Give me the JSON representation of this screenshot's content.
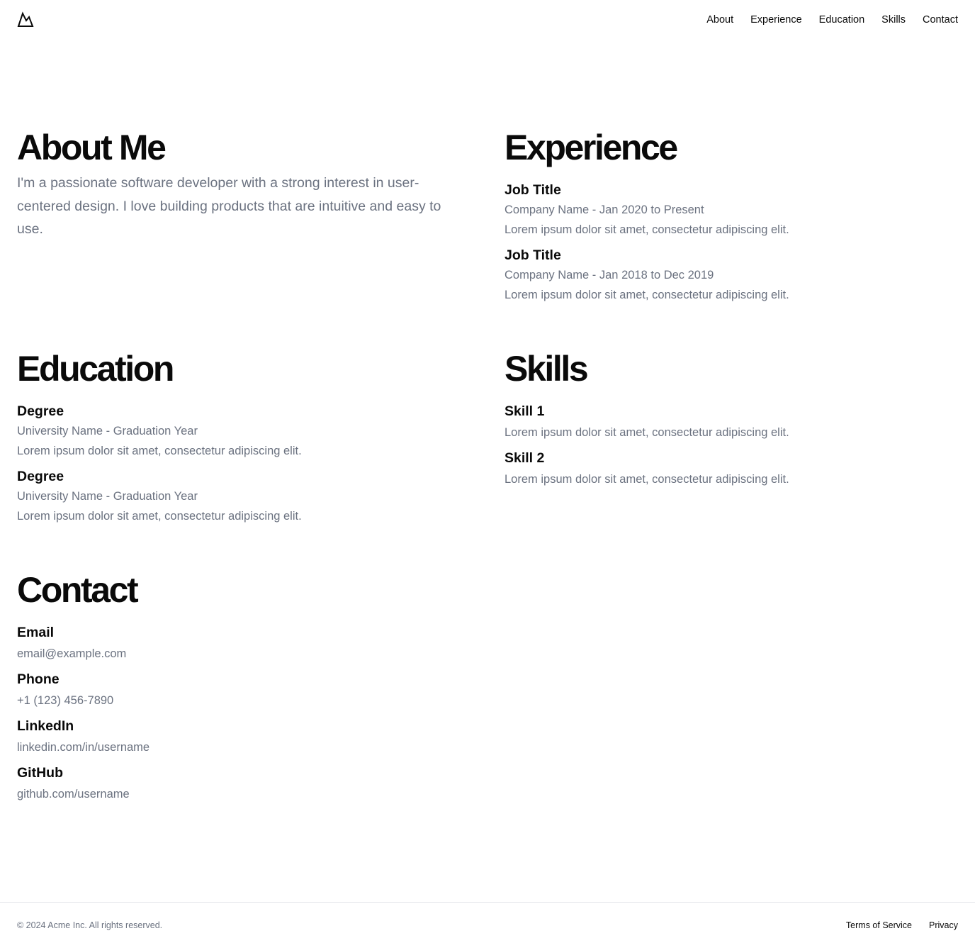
{
  "header": {
    "logo_icon": "mountain-icon",
    "nav": [
      "About",
      "Experience",
      "Education",
      "Skills",
      "Contact"
    ]
  },
  "about": {
    "title": "About Me",
    "text": "I'm a passionate software developer with a strong interest in user-centered design. I love building products that are intuitive and easy to use."
  },
  "experience": {
    "title": "Experience",
    "items": [
      {
        "title": "Job Title",
        "meta": "Company Name - Jan 2020 to Present",
        "desc": "Lorem ipsum dolor sit amet, consectetur adipiscing elit."
      },
      {
        "title": "Job Title",
        "meta": "Company Name - Jan 2018 to Dec 2019",
        "desc": "Lorem ipsum dolor sit amet, consectetur adipiscing elit."
      }
    ]
  },
  "education": {
    "title": "Education",
    "items": [
      {
        "title": "Degree",
        "meta": "University Name - Graduation Year",
        "desc": "Lorem ipsum dolor sit amet, consectetur adipiscing elit."
      },
      {
        "title": "Degree",
        "meta": "University Name - Graduation Year",
        "desc": "Lorem ipsum dolor sit amet, consectetur adipiscing elit."
      }
    ]
  },
  "skills": {
    "title": "Skills",
    "items": [
      {
        "title": "Skill 1",
        "desc": "Lorem ipsum dolor sit amet, consectetur adipiscing elit."
      },
      {
        "title": "Skill 2",
        "desc": "Lorem ipsum dolor sit amet, consectetur adipiscing elit."
      }
    ]
  },
  "contact": {
    "title": "Contact",
    "items": [
      {
        "label": "Email",
        "value": "email@example.com"
      },
      {
        "label": "Phone",
        "value": "+1 (123) 456-7890"
      },
      {
        "label": "LinkedIn",
        "value": "linkedin.com/in/username"
      },
      {
        "label": "GitHub",
        "value": "github.com/username"
      }
    ]
  },
  "footer": {
    "copyright": "© 2024 Acme Inc. All rights reserved.",
    "links": [
      "Terms of Service",
      "Privacy"
    ]
  }
}
